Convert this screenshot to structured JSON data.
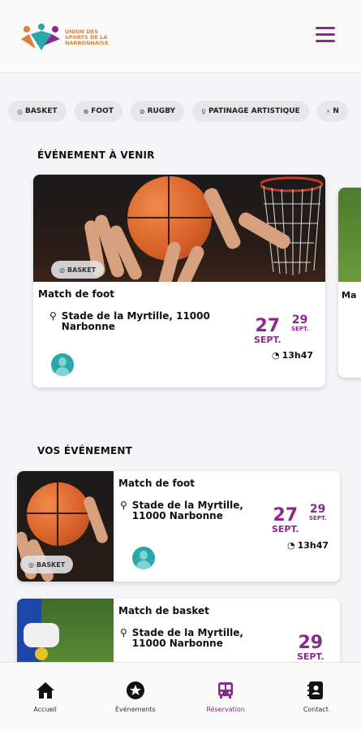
{
  "header": {
    "logo_text": "UNION DES SPORTS DE LA NARBONNAISE",
    "menu_icon": "hamburger-menu-icon"
  },
  "colors": {
    "accent": "#8a2a8e",
    "teal": "#2aa7a8",
    "orange": "#e0803a"
  },
  "chips": [
    {
      "icon": "basketball-icon",
      "glyph": "◎",
      "label": "BASKET"
    },
    {
      "icon": "football-icon",
      "glyph": "⊛",
      "label": "FOOT"
    },
    {
      "icon": "rugby-icon",
      "glyph": "⊘",
      "label": "RUGBY"
    },
    {
      "icon": "skate-icon",
      "glyph": "♀",
      "label": "PATINAGE ARTISTIQUE"
    },
    {
      "icon": "sport-icon",
      "glyph": "⚡",
      "label": "N"
    }
  ],
  "upcoming": {
    "section_title": "ÉVÉNEMENT À VENIR",
    "card": {
      "badge": "BASKET",
      "badge_glyph": "◎",
      "title": "Match de foot",
      "location_line1": "Stade de la Myrtille, 11000",
      "location_line2": "Narbonne",
      "date_day": "27",
      "date_month": "SEPT.",
      "end_day": "29",
      "end_month": "SEPT.",
      "time": "13h47"
    },
    "peek_title": "Ma"
  },
  "mine": {
    "section_title": "VOS ÉVÉNEMENT",
    "cards": [
      {
        "badge": "BASKET",
        "badge_glyph": "◎",
        "title": "Match de foot",
        "location_line1": "Stade de la Myrtille,",
        "location_line2": "11000 Narbonne",
        "date_day": "27",
        "date_month": "SEPT.",
        "end_day": "29",
        "end_month": "SEPT.",
        "time": "13h47"
      },
      {
        "title": "Match de basket",
        "location_line1": "Stade de la Myrtille,",
        "location_line2": "11000 Narbonne",
        "date_day": "29",
        "date_month": "SEPT."
      }
    ]
  },
  "nav": [
    {
      "label": "Accueil",
      "icon": "home-icon"
    },
    {
      "label": "Événements",
      "icon": "star-icon"
    },
    {
      "label": "Réservation",
      "icon": "bus-icon",
      "active": true
    },
    {
      "label": "Contact",
      "icon": "contact-book-icon"
    }
  ]
}
